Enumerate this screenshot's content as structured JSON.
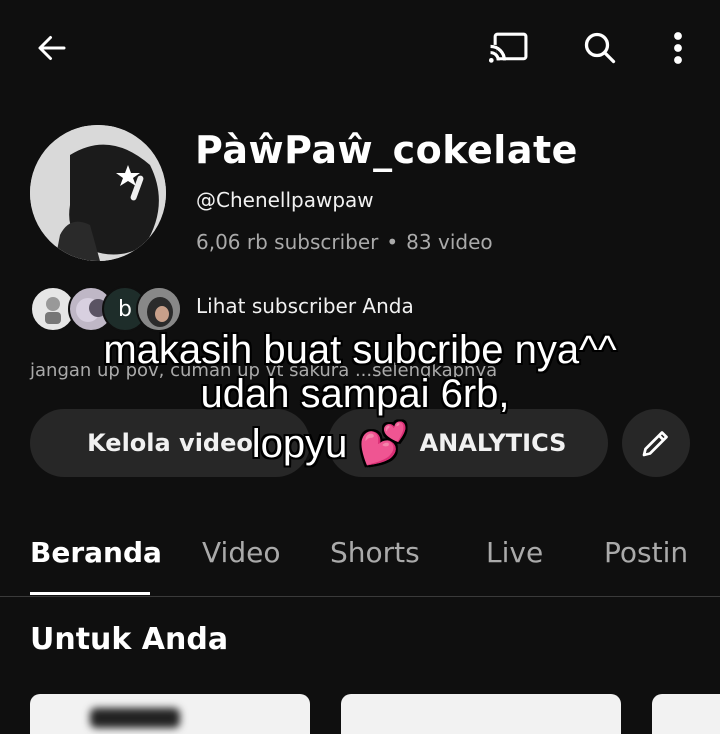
{
  "topbar": {
    "back_icon": "arrow-left-icon",
    "cast_icon": "cast-icon",
    "search_icon": "search-icon",
    "more_icon": "more-vertical-icon"
  },
  "channel": {
    "name": "PàŵPaŵ_cokelate",
    "handle": "@Chenellpawpaw",
    "subscribers": "6,06 rb subscriber",
    "separator": "•",
    "videos": "83 video"
  },
  "subscribers_row": {
    "avatar_letter": "b",
    "label": "Lihat subscriber Anda"
  },
  "description": "jangan up pov, cuman up vt sakura ...selengkapnya",
  "buttons": {
    "manage_videos": "Kelola video",
    "analytics": "ANALYTICS",
    "edit_icon": "pencil-icon"
  },
  "overlay_caption": {
    "line1": "makasih buat subcribe nya^^",
    "line2": "udah sampai 6rb,",
    "line3": "lopyu 💕"
  },
  "tabs": [
    "Beranda",
    "Video",
    "Shorts",
    "Live",
    "Postin"
  ],
  "active_tab": "Beranda",
  "section_title": "Untuk Anda",
  "colors": {
    "background": "#0f0f0f",
    "button_bg": "#272727",
    "secondary_text": "#aaaaaa"
  }
}
